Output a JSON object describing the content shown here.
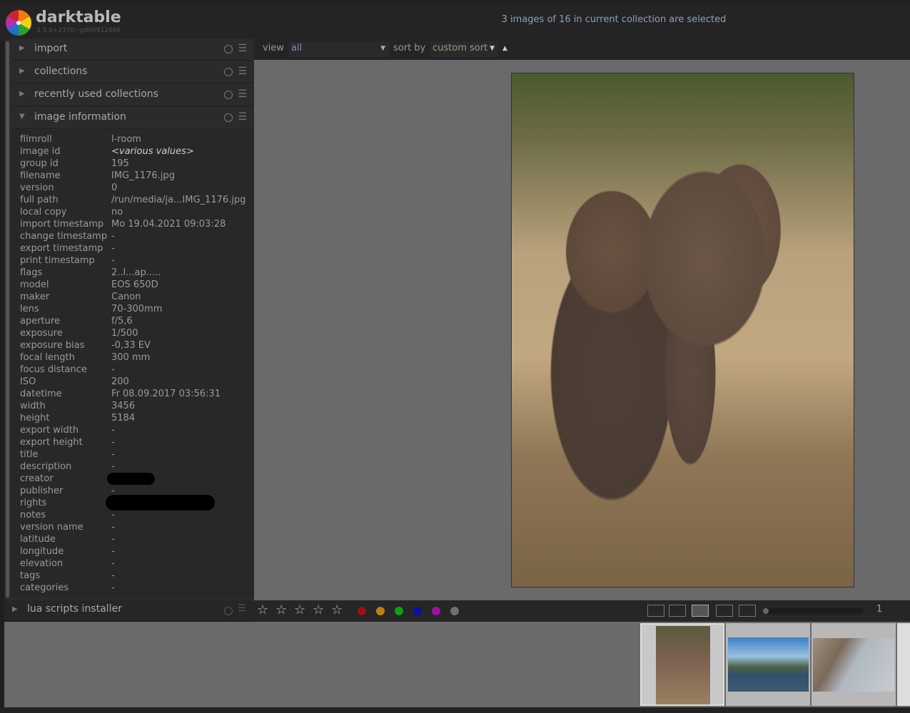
{
  "app": {
    "name": "darktable",
    "version": "3.5.0+2370~gd06912666"
  },
  "status": "3 images of 16 in current collection are selected",
  "modules": [
    {
      "label": "import"
    },
    {
      "label": "collections"
    },
    {
      "label": "recently used collections"
    },
    {
      "label": "image information"
    }
  ],
  "bottom_module": {
    "label": "lua scripts installer"
  },
  "info": [
    [
      "filmroll",
      "l-room"
    ],
    [
      "image id",
      "<various values>"
    ],
    [
      "group id",
      "195"
    ],
    [
      "filename",
      "IMG_1176.jpg"
    ],
    [
      "version",
      "0"
    ],
    [
      "full path",
      "/run/media/ja...IMG_1176.jpg"
    ],
    [
      "local copy",
      "no"
    ],
    [
      "import timestamp",
      "Mo 19.04.2021 09:03:28"
    ],
    [
      "change timestamp",
      "-"
    ],
    [
      "export timestamp",
      "-"
    ],
    [
      "print timestamp",
      "-"
    ],
    [
      "flags",
      "2..l...ap....."
    ],
    [
      "model",
      "EOS 650D"
    ],
    [
      "maker",
      "Canon"
    ],
    [
      "lens",
      "70-300mm"
    ],
    [
      "aperture",
      "f/5,6"
    ],
    [
      "exposure",
      "1/500"
    ],
    [
      "exposure bias",
      "-0,33 EV"
    ],
    [
      "focal length",
      "300 mm"
    ],
    [
      "focus distance",
      "-"
    ],
    [
      "ISO",
      "200"
    ],
    [
      "datetime",
      "Fr 08.09.2017 03:56:31"
    ],
    [
      "width",
      "3456"
    ],
    [
      "height",
      "5184"
    ],
    [
      "export width",
      "-"
    ],
    [
      "export height",
      "-"
    ],
    [
      "title",
      "-"
    ],
    [
      "description",
      "-"
    ],
    [
      "creator",
      ""
    ],
    [
      "publisher",
      "-"
    ],
    [
      "rights",
      ""
    ],
    [
      "notes",
      "-"
    ],
    [
      "version name",
      "-"
    ],
    [
      "latitude",
      "-"
    ],
    [
      "longitude",
      "-"
    ],
    [
      "elevation",
      "-"
    ],
    [
      "tags",
      "-"
    ],
    [
      "categories",
      "-"
    ]
  ],
  "toolbar": {
    "view_label": "view",
    "view_value": "all",
    "sort_label": "sort by",
    "sort_value": "custom sort"
  },
  "colors": [
    "#a01010",
    "#c08010",
    "#10a010",
    "#1010a0",
    "#a010a0",
    "#707070"
  ],
  "zoom_count": "1"
}
